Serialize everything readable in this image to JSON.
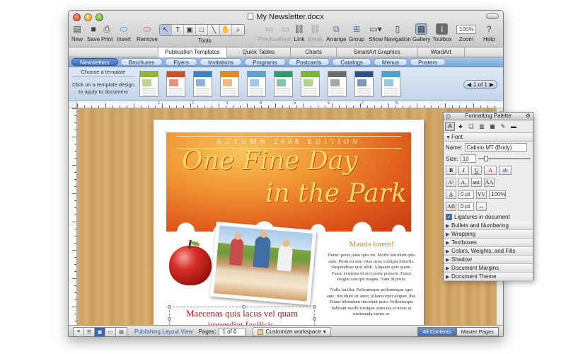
{
  "window": {
    "title": "My Newsletter.docx"
  },
  "toolbar": {
    "new": "New",
    "save": "Save",
    "print": "Print",
    "insert": "Insert",
    "remove": "Remove",
    "tools": "Tools",
    "previous": "Previous",
    "next": "Next",
    "link": "Link",
    "break": "Break",
    "arrange": "Arrange",
    "group": "Group",
    "show": "Show",
    "navigation": "Navigation",
    "gallery": "Gallery",
    "toolbox": "Toolbox",
    "zoom": "Zoom",
    "zoom_value": "100%",
    "help": "Help"
  },
  "gallery_tabs": [
    "Publication Templates",
    "Quick Tables",
    "Charts",
    "SmartArt Graphics",
    "WordArt"
  ],
  "category_tabs": [
    "Newsletters",
    "Brochures",
    "Flyers",
    "Invitations",
    "Programs",
    "Postcards",
    "Catalogs",
    "Menus",
    "Posters"
  ],
  "gallery": {
    "choose": "Choose a template",
    "hint": "Click on a template design to apply to document",
    "pager": "1 of 1",
    "thumb_colors": [
      "#8fb83a",
      "#d64a2a",
      "#3f7fc5",
      "#e88a22",
      "#5da3d8",
      "#2f9a6a",
      "#7bb83a",
      "#6a6a6a",
      "#2b4e8c",
      "#4aa3d1"
    ]
  },
  "document": {
    "edition": "AUTUMN 2008 EDITION",
    "headline_1": "One Fine Day",
    "headline_2": "in the Park",
    "caption": "Maecenas quis lacus vel quam imperdiet facilisis.",
    "side_heading": "Mauris lorem!",
    "para_1": "Donec porta justo quis mi. Morbi tincidunt quis ante. Proin eu sem vitae urna volutpat lobortis. Suspendisse quis nibh. Aliquam quis quam. Fusce et metus id orci porta posuere. Fusce feugiat suscipit magna. Nam id porta.",
    "para_2": "Nulla facilisi. Pellentesque pellentesque eget ante, tincidunt sit amet, ullamcorper aliquet, dui. Etiam bibendum tincidunt justo. Pellentesque habitant morbi tristique senectus et netus et malesuada fames ac"
  },
  "status": {
    "view_label": "Publishing Layout View",
    "pages_label": "Pages:",
    "pages_value": "1 of 6",
    "workspace": "Customize workspace",
    "all_contents": "All Contents",
    "master_pages": "Master Pages"
  },
  "palette": {
    "title": "Formatting Palette",
    "font_section": "Font",
    "name_label": "Name:",
    "name_value": "Calisto MT (Body)",
    "size_label": "Size:",
    "size_value": "10",
    "spacing_1": "0 pt",
    "spacing_2": "0 pt",
    "scale": "100%",
    "ligatures": "Ligatures in document",
    "sections": [
      "Bullets and Numbering",
      "Wrapping",
      "Textboxes",
      "Colors, Weights, and Fills",
      "Shadow",
      "Document Margins",
      "Document Theme"
    ]
  },
  "ruler": {
    "marks": [
      "1",
      "2",
      "3",
      "4",
      "5",
      "6",
      "7",
      "8"
    ]
  }
}
